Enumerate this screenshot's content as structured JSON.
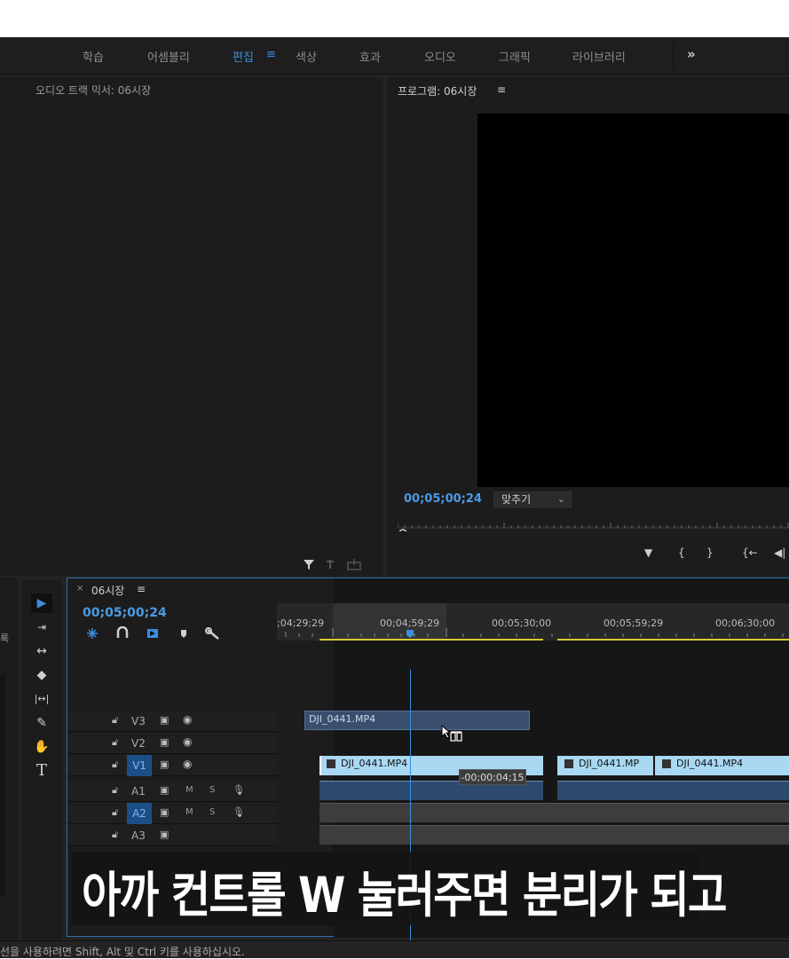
{
  "workspaces": {
    "items": [
      "학습",
      "어셈블리",
      "편집",
      "색상",
      "효과",
      "오디오",
      "그래픽",
      "라이브러리"
    ],
    "active_index": 2,
    "menu_glyph": "≡",
    "more_glyph": "»"
  },
  "audio_mixer": {
    "title": "오디오 트랙 믹서: 06시장"
  },
  "program_monitor": {
    "title": "프로그램: 06시장",
    "title_menu": "≡",
    "timecode": "00;05;00;24",
    "fit_label": "맞추기",
    "fit_chevron": "⌄",
    "controls": [
      "▼",
      "{",
      "}",
      "{←",
      "◀|"
    ]
  },
  "left_strip_label": "록",
  "tools": [
    "selection-tool",
    "track-select-tool",
    "ripple-edit-tool",
    "razor-tool",
    "slip-tool",
    "pen-tool",
    "hand-tool",
    "type-tool"
  ],
  "tools_glyphs": [
    "▶",
    "⇥",
    "↔",
    "◆",
    "|↔|",
    "✎",
    "✋",
    "T"
  ],
  "timeline": {
    "close_glyph": "×",
    "sequence_name": "06시장",
    "menu_glyph": "≡",
    "timecode": "00;05;00;24",
    "ruler_ticks": [
      ";04;29;29",
      "00;04;59;29",
      "00;05;30;00",
      "00;05;59;29",
      "00;06;30;00"
    ],
    "tracks": [
      {
        "name": "V3",
        "type": "video"
      },
      {
        "name": "V2",
        "type": "video"
      },
      {
        "name": "V1",
        "type": "video",
        "highlight": true
      },
      {
        "name": "A1",
        "type": "audio"
      },
      {
        "name": "A2",
        "type": "audio",
        "highlight": true
      },
      {
        "name": "A3",
        "type": "audio"
      }
    ],
    "clips": {
      "v3": "DJI_0441.MP4",
      "v1_a": "DJI_0441.MP4",
      "v1_b": "DJI_0441.MP",
      "v1_c": "DJI_0441.MP4"
    },
    "drag_tooltip": "-00;00;04;15",
    "audio_letters": {
      "m": "M",
      "s": "S"
    }
  },
  "caption": "아까 컨트롤 W 눌러주면 분리가 되고",
  "status_bar": "선을 사용하려면 Shift, Alt 및 Ctrl 키를 사용하십시오.",
  "colors": {
    "accent": "#3b8de0",
    "clip_blue": "#a9d8f3",
    "clip_dark": "#3a4f6e",
    "work_area_yellow": "#d8c933"
  }
}
